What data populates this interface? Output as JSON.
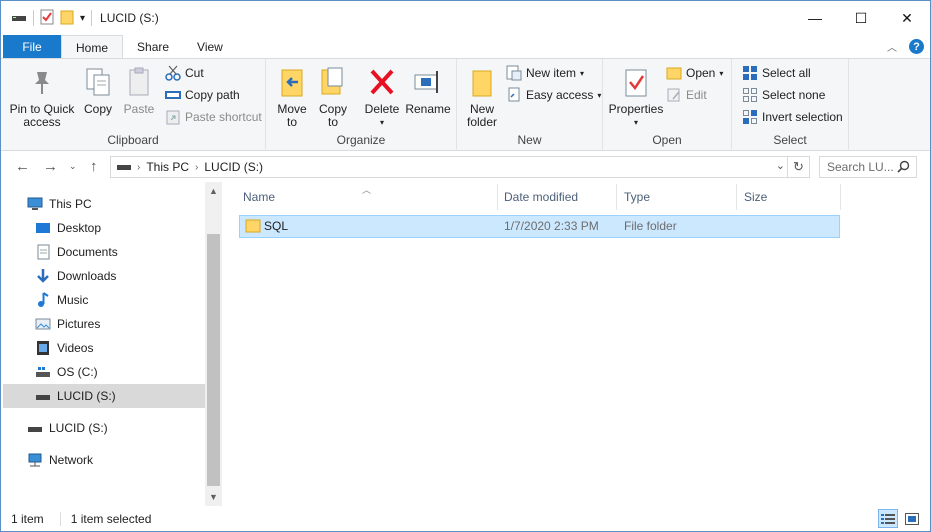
{
  "window": {
    "title": "LUCID (S:)"
  },
  "controls": {
    "minimize": "—",
    "maximize": "☐",
    "close": "✕"
  },
  "tabs": [
    {
      "label": "File"
    },
    {
      "label": "Home"
    },
    {
      "label": "Share"
    },
    {
      "label": "View"
    }
  ],
  "ribbon": {
    "clipboard": {
      "label": "Clipboard",
      "pin": "Pin to Quick access",
      "pin_l1": "Pin to Quick",
      "pin_l2": "access",
      "copy": "Copy",
      "paste": "Paste",
      "cut": "Cut",
      "copy_path": "Copy path",
      "paste_shortcut": "Paste shortcut"
    },
    "organize": {
      "label": "Organize",
      "move_to": "Move",
      "move_to_2": "to",
      "copy_to": "Copy",
      "copy_to_2": "to",
      "delete": "Delete",
      "rename": "Rename"
    },
    "new": {
      "label": "New",
      "new_folder_1": "New",
      "new_folder_2": "folder",
      "new_item": "New item",
      "easy_access": "Easy access"
    },
    "open": {
      "label": "Open",
      "properties": "Properties",
      "open": "Open",
      "edit": "Edit"
    },
    "select": {
      "label": "Select",
      "select_all": "Select all",
      "select_none": "Select none",
      "invert": "Invert selection"
    }
  },
  "address": {
    "crumbs": [
      "This PC",
      "LUCID (S:)"
    ],
    "search_placeholder": "Search LU..."
  },
  "nav": {
    "items": [
      {
        "label": "This PC",
        "icon": "computer-icon"
      },
      {
        "label": "Desktop",
        "icon": "desktop-icon"
      },
      {
        "label": "Documents",
        "icon": "documents-icon"
      },
      {
        "label": "Downloads",
        "icon": "downloads-icon"
      },
      {
        "label": "Music",
        "icon": "music-icon"
      },
      {
        "label": "Pictures",
        "icon": "pictures-icon"
      },
      {
        "label": "Videos",
        "icon": "videos-icon"
      },
      {
        "label": "OS (C:)",
        "icon": "os-drive-icon"
      },
      {
        "label": "LUCID (S:)",
        "icon": "drive-icon"
      },
      {
        "label": "LUCID (S:)",
        "icon": "drive-icon"
      },
      {
        "label": "Network",
        "icon": "network-icon"
      }
    ]
  },
  "columns": [
    {
      "label": "Name"
    },
    {
      "label": "Date modified"
    },
    {
      "label": "Type"
    },
    {
      "label": "Size"
    }
  ],
  "files": [
    {
      "name": "SQL",
      "date": "1/7/2020 2:33 PM",
      "type": "File folder",
      "size": ""
    }
  ],
  "status": {
    "count": "1 item",
    "selected": "1 item selected"
  },
  "colors": {
    "accent": "#1979ca",
    "selection": "#cce8ff",
    "folder": "#ffd566"
  }
}
